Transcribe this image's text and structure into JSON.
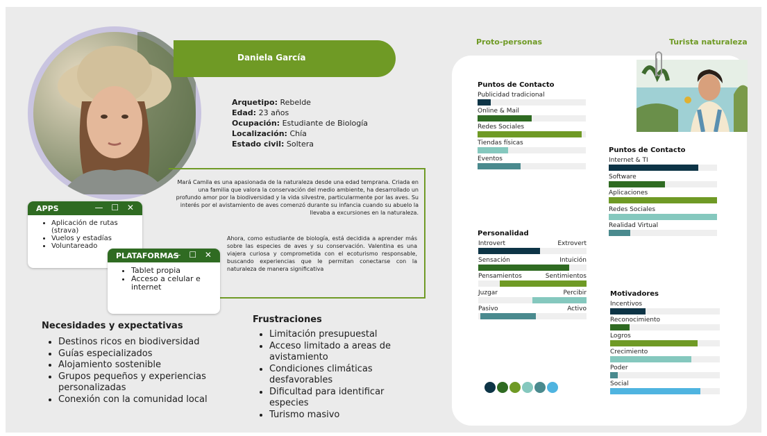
{
  "header": {
    "tag_left": "Proto-personas",
    "tag_right": "Turista naturaleza"
  },
  "profile": {
    "name": "Daniela García",
    "arquetipo_label": "Arquetipo:",
    "arquetipo": " Rebelde",
    "edad_label": "Edad:",
    "edad": " 23 años",
    "ocupacion_label": "Ocupación:",
    "ocupacion": " Estudiante de Biología",
    "localizacion_label": "Localización:",
    "localizacion": " Chía",
    "estado_label": "Estado civil:",
    "estado": " Soltera"
  },
  "bio": {
    "p1": "Mará Camila es una apasionada de la naturaleza desde una edad temprana. Criada en una familia que valora la conservación del medio ambiente, ha desarrollado un profundo amor por la biodiversidad y la vida silvestre, particularmente por las aves. Su interés por el avistamiento de aves comenzó durante su infancia cuando su abuelo la llevaba a excursiones en la naturaleza.",
    "p2": "Ahora, como estudiante de biología, está decidida a aprender más sobre las especies de aves y su conservación. Valentina es una viajera curiosa y comprometida con el ecoturismo responsable, buscando experiencias que le permitan conectarse con la naturaleza de manera significativa"
  },
  "apps": {
    "title": "APPS",
    "controls": "— ☐ ✕",
    "items": [
      "Aplicación de rutas (strava)",
      "Vuelos y estadías",
      "Voluntareado"
    ]
  },
  "plataformas": {
    "title": "PLATAFORMAS",
    "controls": "— ☐ ✕",
    "items": [
      "Tablet propia",
      "Acceso a celular e internet"
    ]
  },
  "necesidades": {
    "title": "Necesidades y expectativas",
    "items": [
      "Destinos ricos en biodiversidad",
      "Guías especializados",
      "Alojamiento sostenible",
      "Grupos pequeños y experiencias personalizadas",
      "Conexión con la comunidad local"
    ]
  },
  "frustraciones": {
    "title": "Frustraciones",
    "items": [
      "Limitación presupuestal",
      "Acceso limitado a areas de avistamiento",
      "Condiciones climáticas desfavorables",
      "Dificultad para identificar especies",
      "Turismo masivo"
    ]
  },
  "chart_data": [
    {
      "type": "bar",
      "title": "Puntos de Contacto",
      "categories": [
        "Publicidad tradicional",
        "Online & Mail",
        "Redes Sociales",
        "Tiendas físicas",
        "Eventos"
      ],
      "values": [
        12,
        50,
        96,
        28,
        40
      ],
      "colors": [
        "#0d3446",
        "#2f6b22",
        "#6f9a25",
        "#85c8be",
        "#4a8a8e"
      ],
      "ylim": [
        0,
        100
      ]
    },
    {
      "type": "bar",
      "title": "Puntos de Contacto",
      "categories": [
        "Internet & TI",
        "Software",
        "Aplicaciones",
        "Redes Sociales",
        "Realidad Virtual"
      ],
      "values": [
        83,
        52,
        100,
        100,
        20
      ],
      "colors": [
        "#0d3446",
        "#2f6b22",
        "#6f9a25",
        "#85c8be",
        "#4a8a8e"
      ],
      "ylim": [
        0,
        100
      ]
    },
    {
      "type": "bar",
      "title": "Personalidad",
      "categories": [
        {
          "left": "Introvert",
          "right": "Extrovert"
        },
        {
          "left": "Sensación",
          "right": "Intuición"
        },
        {
          "left": "Pensamientos",
          "right": "Sentimientos"
        },
        {
          "left": "Juzgar",
          "right": "Percibir"
        },
        {
          "left": "Pasivo",
          "right": "Activo"
        }
      ],
      "ranges": [
        [
          0,
          57
        ],
        [
          0,
          84
        ],
        [
          20,
          100
        ],
        [
          50,
          100
        ],
        [
          2,
          53
        ]
      ],
      "colors": [
        "#0d3446",
        "#2f6b22",
        "#6f9a25",
        "#85c8be",
        "#4a8a8e"
      ],
      "xlim": [
        0,
        100
      ]
    },
    {
      "type": "bar",
      "title": "Motivadores",
      "categories": [
        "Incentivos",
        "Reconocimiento",
        "Logros",
        "Crecimiento",
        "Poder",
        "Social"
      ],
      "values": [
        32,
        18,
        80,
        74,
        7,
        82
      ],
      "colors": [
        "#0d3446",
        "#2f6b22",
        "#6f9a25",
        "#85c8be",
        "#4a8a8e",
        "#4fb4e0"
      ],
      "ylim": [
        0,
        100
      ]
    }
  ],
  "palette": [
    "#0d3446",
    "#2f6b22",
    "#6f9a25",
    "#85c8be",
    "#4a8a8e",
    "#4fb4e0"
  ]
}
